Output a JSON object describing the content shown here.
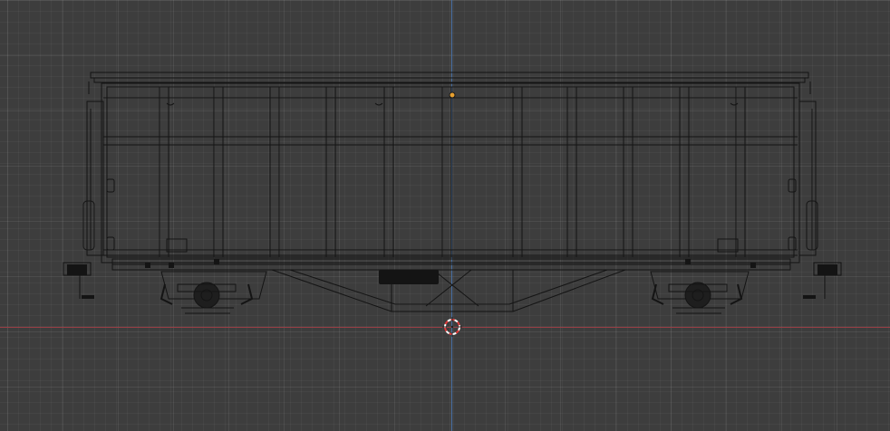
{
  "viewport": {
    "background_color": "#3d3d3d",
    "x_axis_color": "#9a3f45",
    "z_axis_color": "#4a72a6",
    "wire_color": "#141414"
  },
  "objects": [
    {
      "name": "boxcar-wireframe"
    }
  ],
  "cursor": {
    "icon": "3d-cursor-icon",
    "ring_color_a": "#e03a3a",
    "ring_color_b": "#ffffff"
  }
}
